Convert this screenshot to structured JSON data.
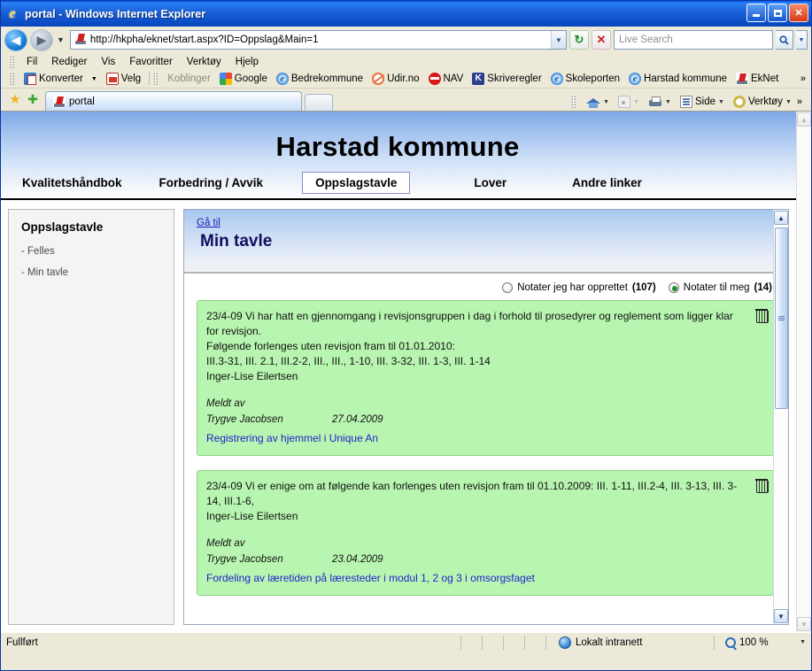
{
  "window": {
    "title": "portal - Windows Internet Explorer",
    "app_icon": "ie-logo-icon",
    "minimize_label": "",
    "maximize_label": "",
    "close_label": "✕"
  },
  "navigation": {
    "back_glyph": "◀",
    "forward_glyph": "▶",
    "history_caret": "▼",
    "url": "http://hkpha/eknet/start.aspx?ID=Oppslag&Main=1",
    "url_dropdown_glyph": "▼",
    "refresh_glyph": "↻",
    "stop_glyph": "✕",
    "search_placeholder": "Live Search",
    "search_value": "",
    "search_go_glyph": "🔍",
    "search_caret_glyph": "▼"
  },
  "menubar": {
    "items": [
      {
        "label": "Fil"
      },
      {
        "label": "Rediger"
      },
      {
        "label": "Vis"
      },
      {
        "label": "Favoritter"
      },
      {
        "label": "Verktøy"
      },
      {
        "label": "Hjelp"
      }
    ]
  },
  "linksbar": {
    "converter_label": "Konverter",
    "converter_caret": "▼",
    "select_label": "Velg",
    "links_label": "Koblinger",
    "links": [
      {
        "label": "Google",
        "icon": "google-icon"
      },
      {
        "label": "Bedrekommune",
        "icon": "ie-icon"
      },
      {
        "label": "Udir.no",
        "icon": "udir-icon"
      },
      {
        "label": "NAV",
        "icon": "nav-icon"
      },
      {
        "label": "Skriveregler",
        "icon": "k-icon"
      },
      {
        "label": "Skoleporten",
        "icon": "ie-icon"
      },
      {
        "label": "Harstad kommune",
        "icon": "ie-icon"
      },
      {
        "label": "EkNet",
        "icon": "eknet-icon"
      }
    ],
    "overflow_glyph": "»"
  },
  "tabbar": {
    "favorites_icon": "star-icon",
    "add_favorite_icon": "add-favorite-icon",
    "tabs": [
      {
        "label": "portal",
        "active": true
      }
    ],
    "new_tab_label": "",
    "commands": [
      {
        "label": "",
        "icon": "home-icon",
        "caret": "▼"
      },
      {
        "label": "",
        "icon": "rss-icon",
        "caret": "▼"
      },
      {
        "label": "",
        "icon": "print-icon",
        "caret": "▼"
      },
      {
        "label": "Side",
        "icon": "page-icon",
        "caret": "▼"
      },
      {
        "label": "Verktøy",
        "icon": "gear-icon",
        "caret": "▼"
      }
    ],
    "overflow_glyph": "»"
  },
  "page": {
    "banner_title": "Harstad kommune",
    "nav": [
      {
        "label": "Kvalitetshåndbok",
        "active": false
      },
      {
        "label": "Forbedring / Avvik",
        "active": false
      },
      {
        "label": "Oppslagstavle",
        "active": true
      },
      {
        "label": "Lover",
        "active": false
      },
      {
        "label": "Andre linker",
        "active": false
      }
    ],
    "sidebar": {
      "title": "Oppslagstavle",
      "items": [
        {
          "label": "- Felles"
        },
        {
          "label": "- Min tavle"
        }
      ]
    },
    "panel": {
      "goto_label": "Gå til",
      "title": "Min tavle",
      "filters": [
        {
          "label": "Notater jeg har opprettet",
          "count": "(107)",
          "selected": false
        },
        {
          "label": "Notater til meg",
          "count": "(14)",
          "selected": true
        }
      ],
      "meldt_av_label": "Meldt av",
      "notes": [
        {
          "body": "23/4-09 Vi har hatt en gjennomgang i revisjonsgruppen i dag i forhold til prosedyrer og reglement som ligger klar for revisjon.\nFølgende forlenges uten revisjon fram til 01.01.2010:\nIII.3-31, III. 2.1, III.2-2, III., III., 1-10, III. 3-32, III. 1-3, III. 1-14\nInger-Lise Eilertsen",
          "author": "Trygve Jacobsen",
          "date": "27.04.2009",
          "link": "Registrering av hjemmel i Unique An",
          "delete_icon": "trash-icon"
        },
        {
          "body": "23/4-09 Vi er enige om at følgende kan forlenges uten revisjon fram til 01.10.2009: III. 1-11, III.2-4, III. 3-13, III. 3-14, III.1-6,\nInger-Lise Eilertsen",
          "author": "Trygve Jacobsen",
          "date": "23.04.2009",
          "link": "Fordeling av læretiden på læresteder i modul 1, 2 og 3 i omsorgsfaget",
          "delete_icon": "trash-icon"
        }
      ]
    }
  },
  "scrollbars": {
    "up_glyph": "▲",
    "down_glyph": "▼"
  },
  "statusbar": {
    "status": "Fullført",
    "zone": "Lokalt intranett",
    "zone_icon": "globe-icon",
    "zoom": "100 %",
    "zoom_caret": "▼"
  },
  "colors": {
    "titlebar": "#0a4bc4",
    "note_green": "#b8f5b0",
    "link_blue": "#2222cc",
    "banner_blue": "#a9c6f0"
  }
}
